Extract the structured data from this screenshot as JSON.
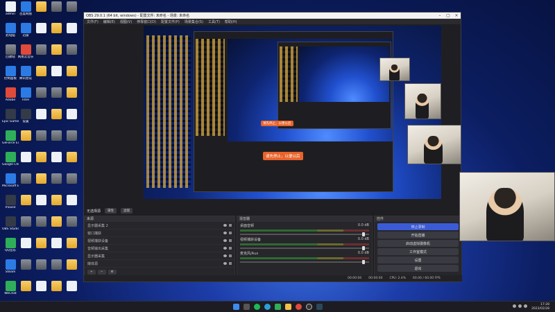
{
  "desktop": {
    "icons": [
      {
        "label": "admin",
        "kind": "doc"
      },
      {
        "label": "此电脑",
        "kind": "app-blue"
      },
      {
        "label": "回收站",
        "kind": "app-thumb"
      },
      {
        "label": "控制面板",
        "kind": "app-blue"
      },
      {
        "label": "Adobe",
        "kind": "app-red"
      },
      {
        "label": "Epic Games Launcher",
        "kind": "app-dark"
      },
      {
        "label": "GeForce Experience",
        "kind": "app-green"
      },
      {
        "label": "Google Chrome",
        "kind": "app-green"
      },
      {
        "label": "Microsoft Edge",
        "kind": "app-blue"
      },
      {
        "label": "mouse",
        "kind": "app-dark"
      },
      {
        "label": "OBS Studio",
        "kind": "app-dark"
      },
      {
        "label": "QQ音乐",
        "kind": "app-green"
      },
      {
        "label": "Steam",
        "kind": "app-blue"
      },
      {
        "label": "WeChat",
        "kind": "app-green"
      },
      {
        "label": "百度网盘",
        "kind": "app-blue"
      },
      {
        "label": "迅雷",
        "kind": "app-blue"
      },
      {
        "label": "网易云音乐",
        "kind": "app-red"
      },
      {
        "label": "腾讯会议",
        "kind": "app-blue"
      },
      {
        "label": "Intel",
        "kind": "app-blue"
      },
      {
        "label": "设置",
        "kind": "app-dark"
      }
    ]
  },
  "obs": {
    "title": "OBS 29.0.1 (64 bit, windows) - 配置文件: 未命名 - 场景: 未命名",
    "menu": [
      "文件(F)",
      "编辑(E)",
      "视图(V)",
      "停靠窗口(D)",
      "配置文件(P)",
      "场景集合(S)",
      "工具(T)",
      "帮助(H)"
    ],
    "preview_tip": "请先停止，以便以后",
    "below_preview": {
      "label": "无选择源",
      "props": "属性",
      "filters": "滤镜"
    },
    "docks": {
      "sources": {
        "title": "来源",
        "items": [
          {
            "label": "显示器采集 2"
          },
          {
            "label": "窗口捕获"
          },
          {
            "label": "视频捕获设备"
          },
          {
            "label": "音频输出采集"
          },
          {
            "label": "显示器采集"
          },
          {
            "label": "媒体源"
          }
        ]
      },
      "mixer": {
        "title": "混音器",
        "channels": [
          {
            "name": "桌面音频",
            "db": "0.0 dB"
          },
          {
            "name": "视频捕获设备",
            "db": "0.0 dB"
          },
          {
            "name": "麦克风/Aux",
            "db": "0.0 dB"
          }
        ]
      },
      "controls": {
        "title": "控件",
        "buttons": [
          "停止录制",
          "开始直播",
          "启动虚拟摄像机",
          "工作室模式",
          "设置",
          "退出"
        ]
      }
    },
    "status": {
      "fps": "60.00 / 60.00 FPS",
      "cpu": "CPU: 2.4%",
      "rec": "00:00:00",
      "live": "00:00:00"
    }
  },
  "taskbar": {
    "time": "17:28",
    "date": "2023/02/28"
  }
}
